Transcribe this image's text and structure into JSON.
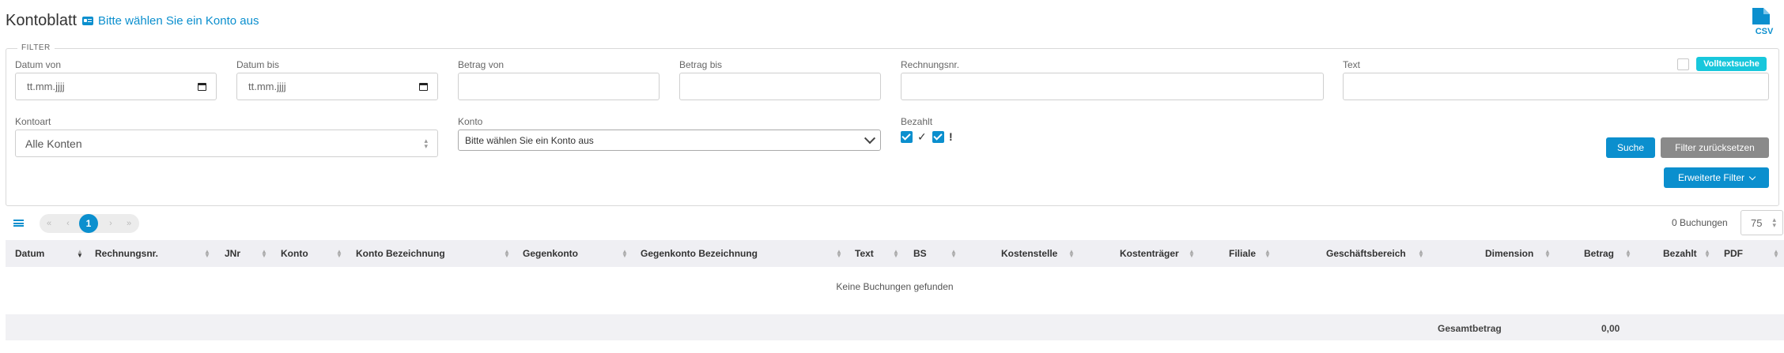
{
  "header": {
    "title": "Kontoblatt",
    "account_link": "Bitte wählen Sie ein Konto aus",
    "csv_label": "CSV"
  },
  "filter": {
    "legend": "FILTER",
    "datum_von": {
      "label": "Datum von",
      "value": "tt.mm.jjjj"
    },
    "datum_bis": {
      "label": "Datum bis",
      "value": "tt.mm.jjjj"
    },
    "betrag_von": {
      "label": "Betrag von",
      "value": ""
    },
    "betrag_bis": {
      "label": "Betrag bis",
      "value": ""
    },
    "rechnungsnr": {
      "label": "Rechnungsnr.",
      "value": ""
    },
    "text": {
      "label": "Text",
      "value": ""
    },
    "volltextsuche": {
      "label": "Volltextsuche",
      "checked": false
    },
    "kontoart": {
      "label": "Kontoart",
      "value": "Alle Konten"
    },
    "konto": {
      "label": "Konto",
      "value": "Bitte wählen Sie ein Konto aus"
    },
    "bezahlt": {
      "label": "Bezahlt",
      "paid_symbol": "✓",
      "unpaid_symbol": "!",
      "paid_checked": true,
      "unpaid_checked": true
    },
    "search_button": "Suche",
    "reset_button": "Filter zurücksetzen",
    "advanced_button": "Erweiterte Filter"
  },
  "pagination": {
    "first": "«",
    "prev": "‹",
    "current": "1",
    "next": "›",
    "last": "»",
    "count_text": "0 Buchungen",
    "per_page": "75"
  },
  "table": {
    "columns": [
      "Datum",
      "Rechnungsnr.",
      "JNr",
      "Konto",
      "Konto Bezeichnung",
      "Gegenkonto",
      "Gegenkonto Bezeichnung",
      "Text",
      "BS",
      "Kostenstelle",
      "Kostenträger",
      "Filiale",
      "Geschäftsbereich",
      "Dimension",
      "Betrag",
      "Bezahlt",
      "PDF"
    ],
    "sorted_column": "Datum",
    "empty_message": "Keine Buchungen gefunden",
    "total_label": "Gesamtbetrag",
    "total_value": "0,00"
  },
  "colors": {
    "accent": "#0b8fce",
    "button_gray": "#8a8a8a",
    "badge_cyan": "#18c7dc",
    "header_bg": "#efeff3"
  },
  "icons": {
    "account": "id-card-icon",
    "csv": "csv-file-icon",
    "date": "calendar-icon",
    "menu": "hamburger-icon",
    "sort": "sort-icon"
  }
}
